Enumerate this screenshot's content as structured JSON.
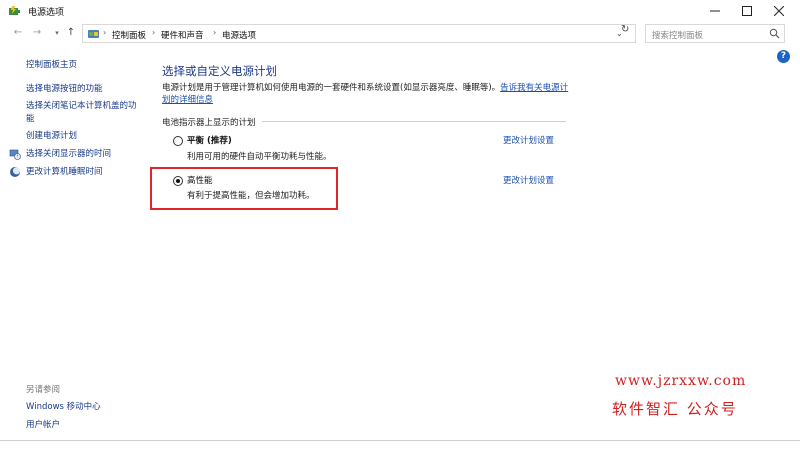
{
  "window": {
    "title": "电源选项",
    "controls": [
      "minimize",
      "maximize",
      "close"
    ]
  },
  "address_bar": {
    "breadcrumbs": [
      "控制面板",
      "硬件和声音",
      "电源选项"
    ],
    "search_placeholder": "搜索控制面板"
  },
  "sidebar": {
    "items": [
      {
        "label": "控制面板主页",
        "icon": ""
      },
      {
        "label": "选择电源按钮的功能",
        "icon": ""
      },
      {
        "label": "选择关闭笔记本计算机盖的功",
        "label_line2": "能",
        "icon": ""
      },
      {
        "label": "创建电源计划",
        "icon": ""
      },
      {
        "label": "选择关闭显示器的时间",
        "icon": "monitor-clock-icon"
      },
      {
        "label": "更改计算机睡眠时间",
        "icon": "moon-icon"
      }
    ],
    "see_also_label": "另请参阅",
    "see_also": [
      "Windows 移动中心",
      "用户帐户"
    ]
  },
  "main": {
    "title": "选择或自定义电源计划",
    "description": "电源计划是用于管理计算机如何使用电源的一套硬件和系统设置(如显示器亮度、睡眠等)。",
    "learn_more": "告诉我有关电源计划的详细信息",
    "section_label": "电池指示器上显示的计划",
    "plans": [
      {
        "name": "平衡 (推荐)",
        "description": "利用可用的硬件自动平衡功耗与性能。",
        "selected": false,
        "change_link": "更改计划设置"
      },
      {
        "name": "高性能",
        "description": "有利于提高性能，但会增加功耗。",
        "selected": true,
        "change_link": "更改计划设置"
      }
    ]
  },
  "watermark": {
    "url": "www.jzrxxw.com",
    "text": "软件智汇 公众号"
  },
  "colors": {
    "link": "#1a4fb0",
    "title": "#1e3a8a",
    "highlight": "#e0262a",
    "watermark": "#d21f1f"
  }
}
